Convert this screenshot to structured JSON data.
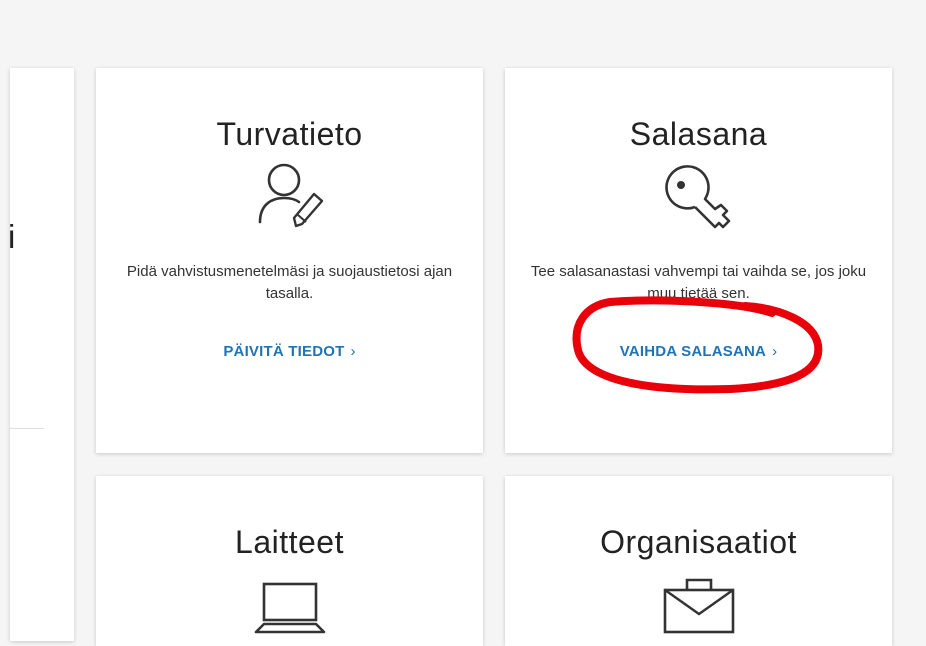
{
  "partial_card": {
    "title_fragment": "i"
  },
  "cards": [
    {
      "title": "Turvatieto",
      "icon": "user-edit-icon",
      "description": "Pidä vahvistusmenetelmäsi ja suojaustietosi ajan tasalla.",
      "link": "PÄIVITÄ TIEDOT"
    },
    {
      "title": "Salasana",
      "icon": "key-icon",
      "description": "Tee salasanastasi vahvempi tai vaihda se, jos joku muu tietää sen.",
      "link": "VAIHDA SALASANA"
    },
    {
      "title": "Laitteet",
      "icon": "laptop-icon"
    },
    {
      "title": "Organisaatiot",
      "icon": "briefcase-icon"
    }
  ],
  "chevron": "›",
  "colors": {
    "link": "#1f73b7",
    "annotation": "#e8000b",
    "background": "#f5f5f5"
  }
}
